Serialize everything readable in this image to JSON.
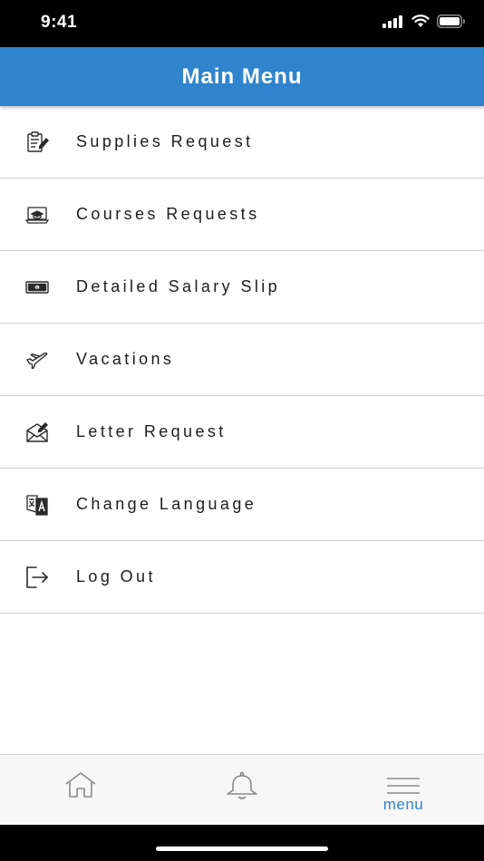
{
  "status_bar": {
    "time": "9:41",
    "icons": [
      "cellular-signal-icon",
      "wifi-icon",
      "battery-icon"
    ]
  },
  "header": {
    "title": "Main Menu"
  },
  "menu": {
    "items": [
      {
        "label": "Supplies Request",
        "icon": "clipboard-edit-icon"
      },
      {
        "label": "Courses Requests",
        "icon": "laptop-course-icon"
      },
      {
        "label": "Detailed Salary Slip",
        "icon": "money-bill-icon"
      },
      {
        "label": "Vacations",
        "icon": "airplane-icon"
      },
      {
        "label": "Letter Request",
        "icon": "envelope-letter-icon"
      },
      {
        "label": "Change Language",
        "icon": "translate-icon"
      },
      {
        "label": "Log Out",
        "icon": "logout-icon"
      }
    ]
  },
  "tab_bar": {
    "tabs": [
      {
        "icon": "home-icon",
        "label": ""
      },
      {
        "icon": "bell-icon",
        "label": ""
      },
      {
        "icon": "hamburger-menu-icon",
        "label": "menu"
      }
    ]
  },
  "colors": {
    "header_bg": "#2f84cd",
    "active_tab": "#2f84cd",
    "inactive_tab_icon": "#8a8a8a",
    "divider": "#cfcfcf"
  }
}
